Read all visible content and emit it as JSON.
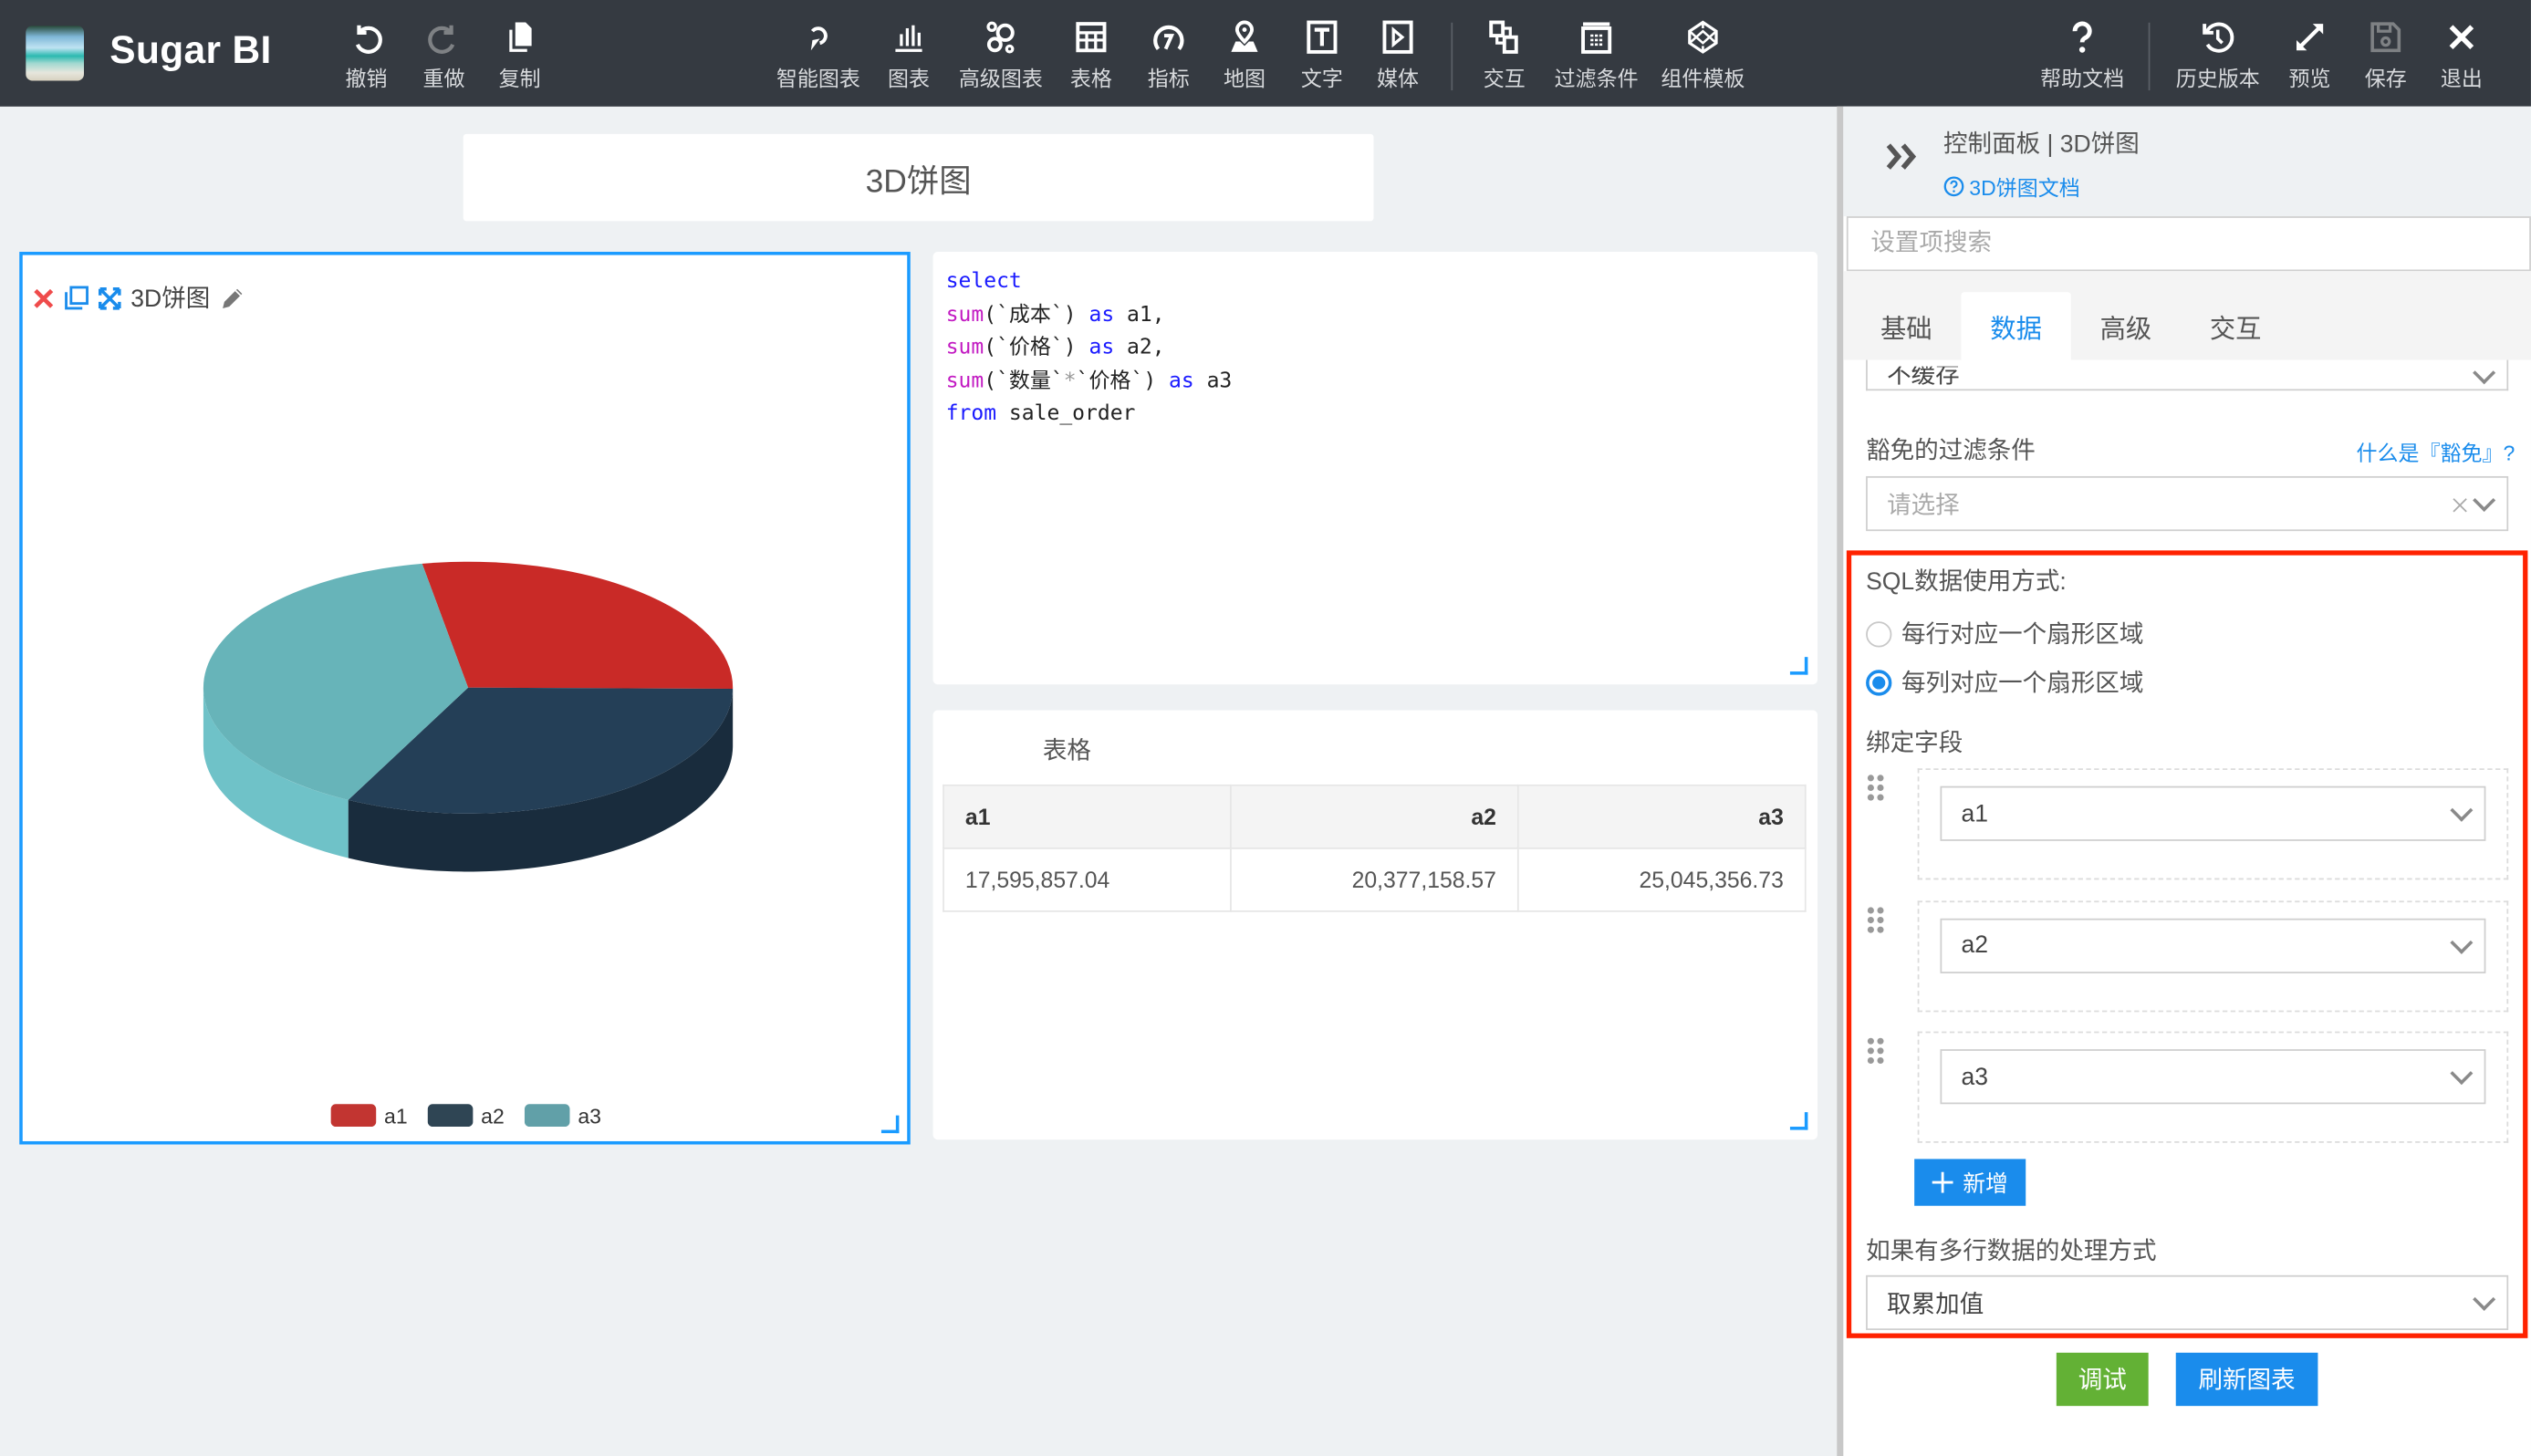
{
  "app": {
    "brand": "Sugar BI"
  },
  "toolbar": {
    "left": [
      {
        "id": "undo",
        "label": "撤销",
        "icon": "undo-icon"
      },
      {
        "id": "redo",
        "label": "重做",
        "icon": "redo-icon",
        "disabled": true
      },
      {
        "id": "copy",
        "label": "复制",
        "icon": "copy-icon"
      }
    ],
    "center": [
      {
        "id": "smart-chart",
        "label": "智能图表",
        "icon": "smart-chart-icon"
      },
      {
        "id": "chart",
        "label": "图表",
        "icon": "bar-chart-icon"
      },
      {
        "id": "advanced-chart",
        "label": "高级图表",
        "icon": "advanced-chart-icon"
      },
      {
        "id": "table",
        "label": "表格",
        "icon": "table-icon"
      },
      {
        "id": "indicator",
        "label": "指标",
        "icon": "gauge-icon"
      },
      {
        "id": "map",
        "label": "地图",
        "icon": "map-pin-icon"
      },
      {
        "id": "text",
        "label": "文字",
        "icon": "text-icon"
      },
      {
        "id": "media",
        "label": "媒体",
        "icon": "media-play-icon"
      },
      {
        "id": "interaction",
        "label": "交互",
        "icon": "interaction-icon"
      },
      {
        "id": "filter",
        "label": "过滤条件",
        "icon": "filter-icon"
      },
      {
        "id": "template",
        "label": "组件模板",
        "icon": "template-icon"
      }
    ],
    "right": [
      {
        "id": "help",
        "label": "帮助文档",
        "icon": "help-icon"
      },
      {
        "id": "history",
        "label": "历史版本",
        "icon": "history-icon"
      },
      {
        "id": "preview",
        "label": "预览",
        "icon": "expand-icon"
      },
      {
        "id": "save",
        "label": "保存",
        "icon": "save-icon",
        "disabled": true
      },
      {
        "id": "exit",
        "label": "退出",
        "icon": "close-icon"
      }
    ]
  },
  "canvas": {
    "title": "3D饼图",
    "chart_panel": {
      "title": "3D饼图"
    },
    "sql": {
      "lines": [
        [
          {
            "t": "select",
            "c": "k1"
          }
        ],
        [
          {
            "t": "sum",
            "c": "k2"
          },
          {
            "t": "(`成本`) "
          },
          {
            "t": "as",
            "c": "k1"
          },
          {
            "t": " a1,"
          }
        ],
        [
          {
            "t": "sum",
            "c": "k2"
          },
          {
            "t": "(`价格`) "
          },
          {
            "t": "as",
            "c": "k1"
          },
          {
            "t": " a2,"
          }
        ],
        [
          {
            "t": "sum",
            "c": "k2"
          },
          {
            "t": "(`数量`"
          },
          {
            "t": "*",
            "c": "k3"
          },
          {
            "t": "`价格`) "
          },
          {
            "t": "as",
            "c": "k1"
          },
          {
            "t": " a3"
          }
        ],
        [
          {
            "t": "from",
            "c": "k1"
          },
          {
            "t": " sale_order"
          }
        ]
      ]
    },
    "table": {
      "title": "表格",
      "columns": [
        "a1",
        "a2",
        "a3"
      ],
      "rows": [
        [
          "17,595,857.04",
          "20,377,158.57",
          "25,045,356.73"
        ]
      ]
    }
  },
  "chart_data": {
    "type": "pie",
    "title": "3D饼图",
    "categories": [
      "a1",
      "a2",
      "a3"
    ],
    "values": [
      17595857.04,
      20377158.57,
      25045356.73
    ],
    "colors": [
      "#c92a27",
      "#243f57",
      "#67b4b9"
    ],
    "legend": "bottom",
    "style": "3d"
  },
  "control_panel": {
    "title": "控制面板 | 3D饼图",
    "doc_link": "3D饼图文档",
    "search_placeholder": "设置项搜索",
    "tabs": [
      "基础",
      "数据",
      "高级",
      "交互"
    ],
    "active_tab": "数据",
    "cache_select_value": "不缓存",
    "filter_label": "豁免的过滤条件",
    "filter_help": "什么是『豁免』?",
    "filter_placeholder": "请选择",
    "sql_usage_label": "SQL数据使用方式:",
    "sql_usage_options": [
      "每行对应一个扇形区域",
      "每列对应一个扇形区域"
    ],
    "sql_usage_selected": 1,
    "bind_fields_label": "绑定字段",
    "bind_fields": [
      "a1",
      "a2",
      "a3"
    ],
    "add_button": "新增",
    "multi_row_label": "如果有多行数据的处理方式",
    "multi_row_value": "取累加值",
    "debug_button": "调试",
    "refresh_button": "刷新图表"
  },
  "colors": {
    "accent": "#1a8cec",
    "highlight_box": "#ff2200",
    "debug_button": "#63b135",
    "topbar": "#353a41"
  }
}
